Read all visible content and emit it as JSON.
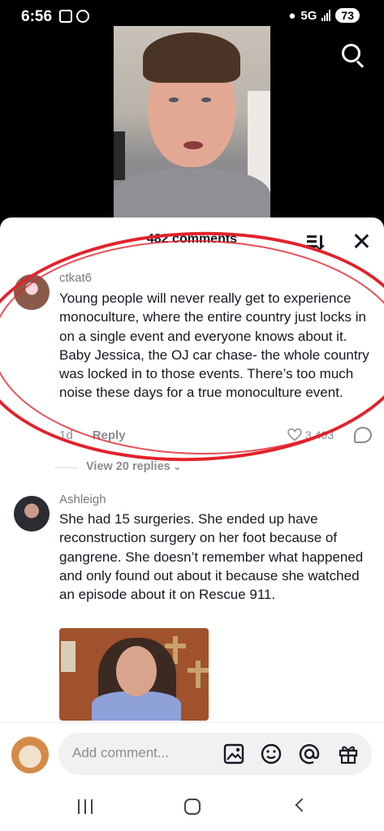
{
  "status_bar": {
    "time": "6:56",
    "network": "5G",
    "battery": "73"
  },
  "sheet": {
    "count_label": "482 comments"
  },
  "comments": [
    {
      "username": "ctkat6",
      "text": "Young people will never really get to experience monoculture, where the entire country just locks in on a single event and everyone knows about it. Baby Jessica, the OJ car chase- the whole country was locked in to those events. There’s too much noise these days for a true monoculture event.",
      "time": "1d",
      "reply_label": "Reply",
      "likes": "3,403",
      "view_replies": "View 20 replies"
    },
    {
      "username": "Ashleigh",
      "text": "She had 15 surgeries. She ended up have reconstruction surgery on her foot because of gangrene. She doesn’t remember what happened and only found out about it because she watched an episode about it on Rescue 911."
    }
  ],
  "input": {
    "placeholder": "Add comment..."
  },
  "colors": {
    "annotation": "#e2222b",
    "text": "#161823",
    "muted": "#8a8b91"
  },
  "icons": [
    "search-icon",
    "sort-icon",
    "close-icon",
    "heart-icon",
    "image-icon",
    "emoji-icon",
    "mention-icon",
    "gift-icon"
  ]
}
